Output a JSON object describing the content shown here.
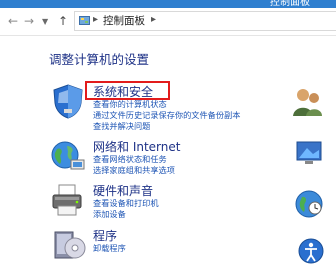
{
  "window": {
    "title": "控制面板"
  },
  "nav": {
    "back_icon": "back-arrow-icon",
    "forward_icon": "forward-arrow-icon",
    "up_icon": "up-arrow-icon",
    "breadcrumb": "控制面板"
  },
  "main": {
    "heading": "调整计算机的设置",
    "categories": [
      {
        "title": "系统和安全",
        "icon": "shield-icon",
        "links": [
          "查看你的计算机状态",
          "通过文件历史记录保存你的文件备份副本",
          "查找并解决问题"
        ]
      },
      {
        "title": "网络和 Internet",
        "icon": "globe-network-icon",
        "links": [
          "查看网络状态和任务",
          "选择家庭组和共享选项"
        ]
      },
      {
        "title": "硬件和声音",
        "icon": "printer-icon",
        "links": [
          "查看设备和打印机",
          "添加设备"
        ]
      },
      {
        "title": "程序",
        "icon": "program-box-icon",
        "links": [
          "卸载程序"
        ]
      }
    ]
  },
  "colors": {
    "titlebar": "#2f7fcf",
    "heading": "#1e3287",
    "link": "#1f56b5",
    "highlight": "#e21b1b"
  }
}
